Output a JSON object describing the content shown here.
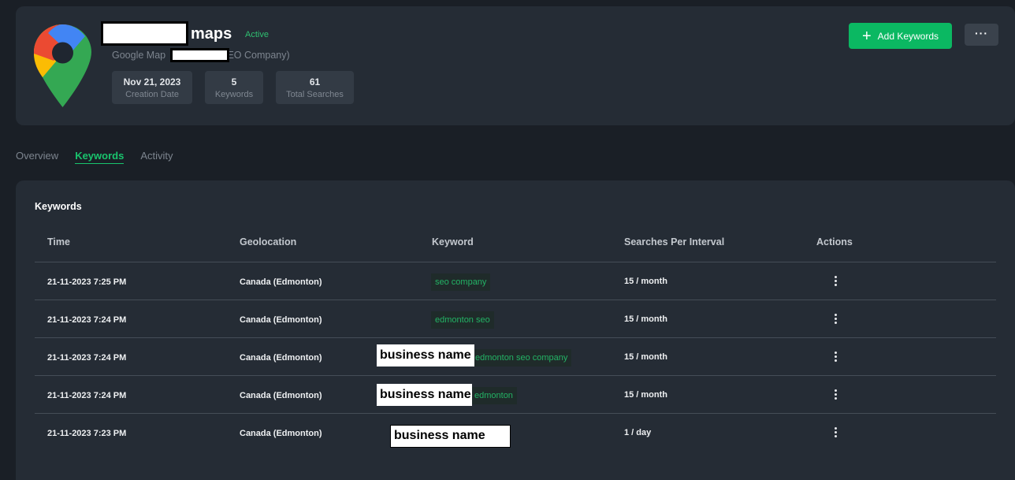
{
  "header": {
    "title": "maps",
    "status": "Active",
    "subtitle_left": "Google Map",
    "subtitle_right": "SEO Company)",
    "stats": [
      {
        "value": "Nov 21, 2023",
        "label": "Creation Date"
      },
      {
        "value": "5",
        "label": "Keywords"
      },
      {
        "value": "61",
        "label": "Total Searches"
      }
    ],
    "add_label": "Add Keywords",
    "more_label": "···"
  },
  "tabs": [
    {
      "label": "Overview"
    },
    {
      "label": "Keywords"
    },
    {
      "label": "Activity"
    }
  ],
  "keywords": {
    "title": "Keywords",
    "columns": [
      "Time",
      "Geolocation",
      "Keyword",
      "Searches Per Interval",
      "Actions"
    ],
    "rows": [
      {
        "time": "21-11-2023 7:25 PM",
        "geo": "Canada (Edmonton)",
        "keyword": "seo company",
        "searches": "15 / month"
      },
      {
        "time": "21-11-2023 7:24 PM",
        "geo": "Canada (Edmonton)",
        "keyword": "edmonton seo",
        "searches": "15 / month"
      },
      {
        "time": "21-11-2023 7:24 PM",
        "geo": "Canada (Edmonton)",
        "keyword": "edmonton seo company",
        "searches": "15 / month",
        "overlay": "business name"
      },
      {
        "time": "21-11-2023 7:24 PM",
        "geo": "Canada (Edmonton)",
        "keyword": "edmonton",
        "searches": "15 / month",
        "overlay": "business name"
      },
      {
        "time": "21-11-2023 7:23 PM",
        "geo": "Canada (Edmonton)",
        "keyword": "",
        "searches": "1 / day",
        "overlay": "business name"
      }
    ]
  },
  "colors": {
    "accent": "#0bb862",
    "background": "#1a1f26",
    "card": "#252c35"
  }
}
